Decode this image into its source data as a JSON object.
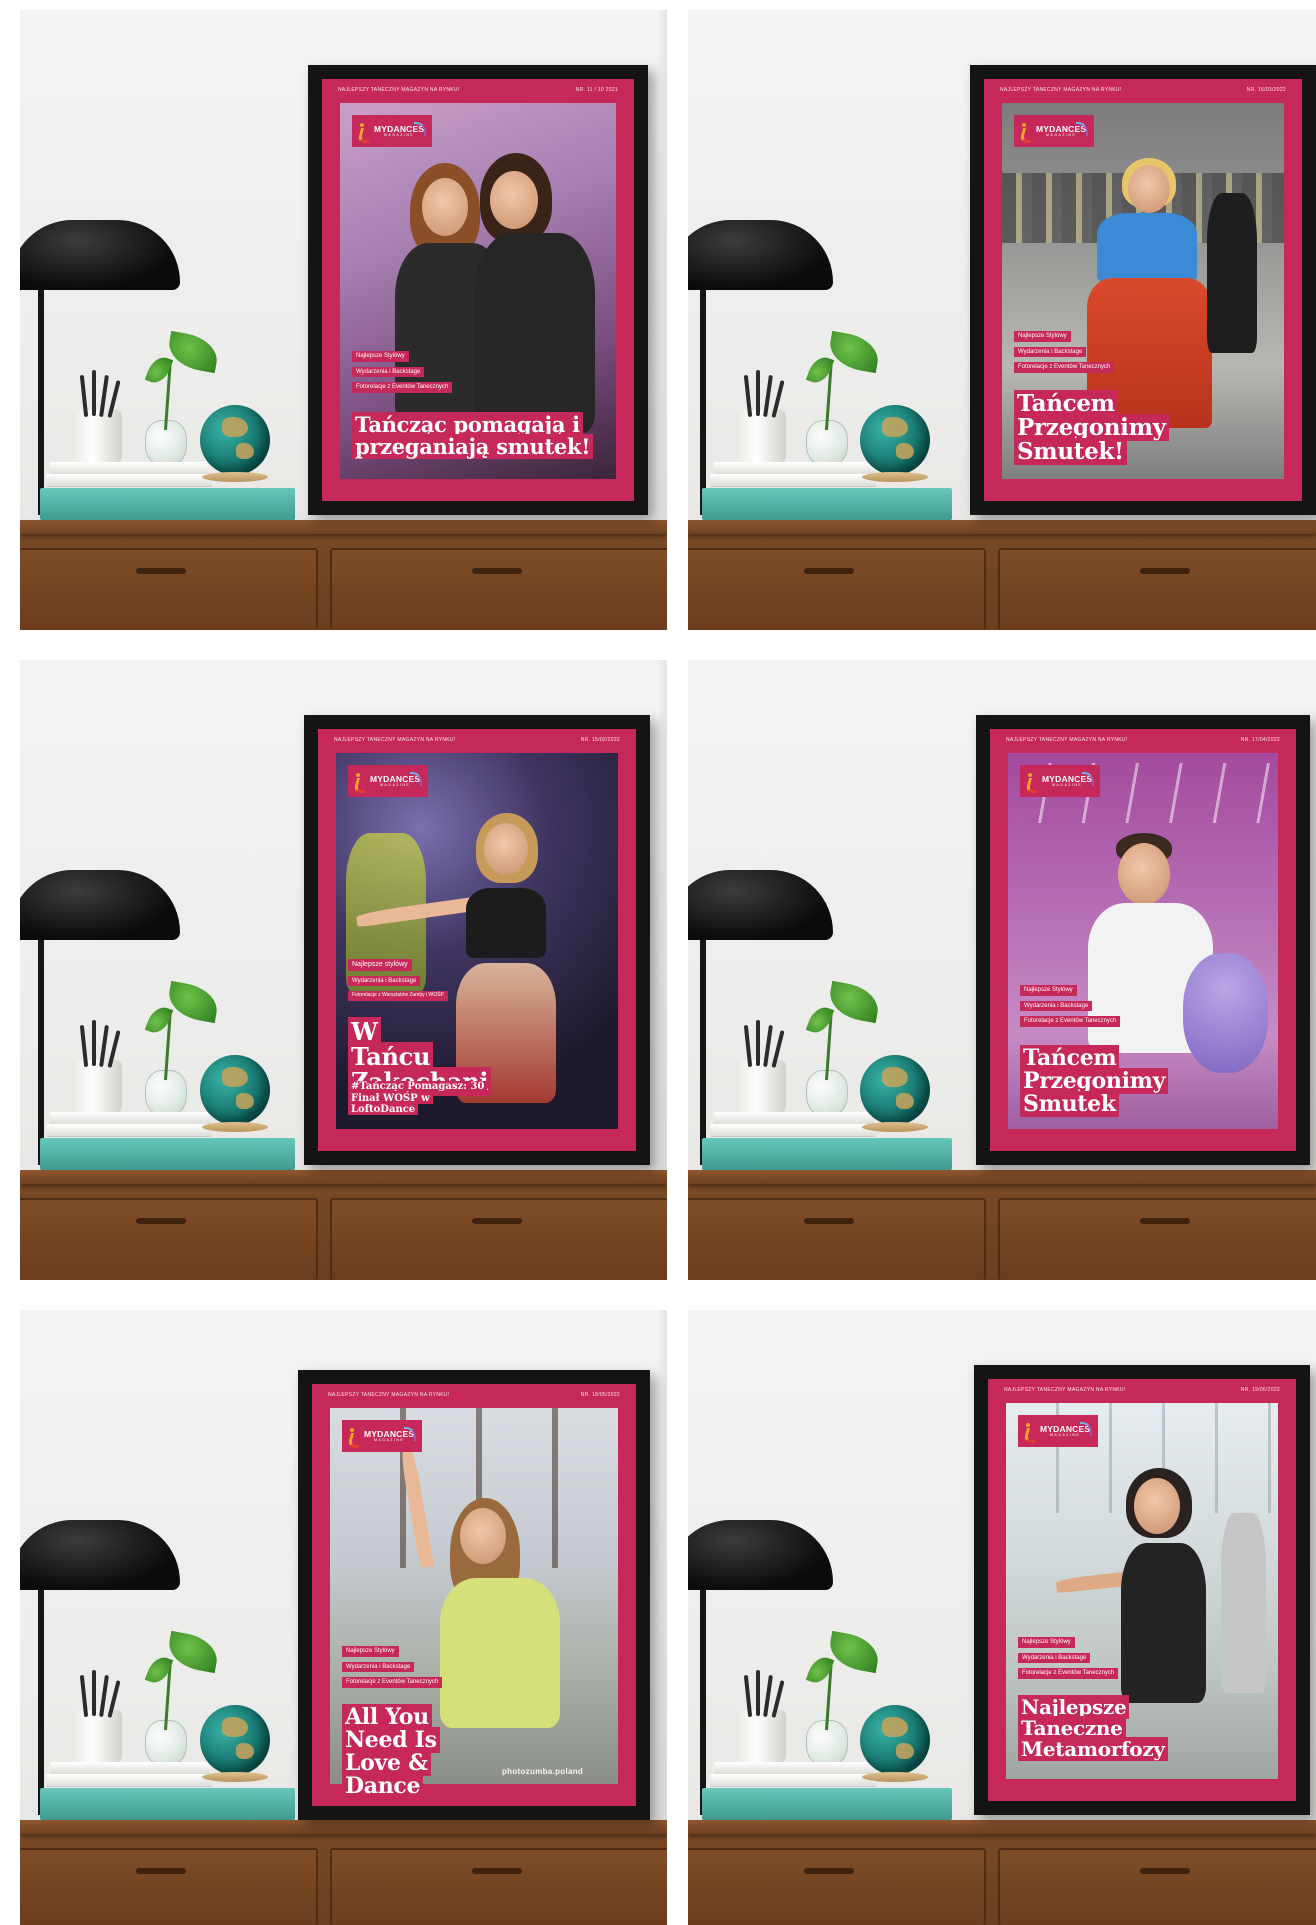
{
  "covers": [
    {
      "header_left": "NAJLEPSZY TANECZNY MAGAZYN NA RYNKU!",
      "header_right": "NR. 11 / 10 2021",
      "logo": {
        "main": "MYDANCES",
        "sub": "MAGAZINE"
      },
      "tags": [
        "Najlepsze Stylówy",
        "Wydarzenia i Backstage",
        "Fotorelacje z Eventów Tanecznych"
      ],
      "headline": "Tańcząc pomagają i przeganiają smutek!",
      "subline": ""
    },
    {
      "header_left": "NAJLEPSZY TANECZNY MAGAZYN NA RYNKU!",
      "header_right": "NR. 16/03/2022",
      "logo": {
        "main": "MYDANCES",
        "sub": "MAGAZINE"
      },
      "tags": [
        "Najlepsze Stylówy",
        "Wydarzenia i Backstage",
        "Fotorelacje z Eventów Tanecznych"
      ],
      "headline": "Tańcem Przegonimy Smutek!",
      "subline": ""
    },
    {
      "header_left": "NAJLEPSZY TANECZNY MAGAZYN NA RYNKU!",
      "header_right": "NR. 15/02/2022",
      "logo": {
        "main": "MYDANCES",
        "sub": "MAGAZINE"
      },
      "tags": [
        "Najlepsze stylówy",
        "Wydarzenia i Backstage",
        "Fotorelacje z Warsztatów Zumby i WOŚP"
      ],
      "headline": "W Tańcu Zakochani",
      "subline": "#Tańcząc Pomagasz: 30 Finał WOŚP w LoftoDance"
    },
    {
      "header_left": "NAJLEPSZY TANECZNY MAGAZYN NA RYNKU!",
      "header_right": "NR. 17/04/2022",
      "logo": {
        "main": "MYDANCES",
        "sub": "MAGAZINE"
      },
      "tags": [
        "Najlepsze Stylówy",
        "Wydarzenia i Backstage",
        "Fotorelacje z Eventów Tanecznych"
      ],
      "headline": "Tańcem Przegonimy Smutek",
      "subline": ""
    },
    {
      "header_left": "NAJLEPSZY TANECZNY MAGAZYN NA RYNKU!",
      "header_right": "NR. 18/05/2022",
      "logo": {
        "main": "MYDANCES",
        "sub": "MAGAZINE"
      },
      "tags": [
        "Najlepsze Stylówy",
        "Wydarzenia i Backstage",
        "Fotorelacje z Eventów Tanecznych"
      ],
      "headline": "All You Need Is Love & Dance",
      "subline": "",
      "credit": "photozumba.poland"
    },
    {
      "header_left": "NAJLEPSZY TANECZNY MAGAZYN NA RYNKU!",
      "header_right": "NR. 19/06/2022",
      "logo": {
        "main": "MYDANCES",
        "sub": "MAGAZINE"
      },
      "tags": [
        "Najlepsze Stylówy",
        "Wydarzenia i Backstage",
        "Fotorelacje z Eventów Tanecznych"
      ],
      "headline": "Najlepsze Taneczne Metamorfozy",
      "subline": ""
    }
  ],
  "colors": {
    "magenta": "#c7285a",
    "frame": "#141414",
    "wood": "#7b4a26",
    "teal_book": "#4fb3a7"
  }
}
